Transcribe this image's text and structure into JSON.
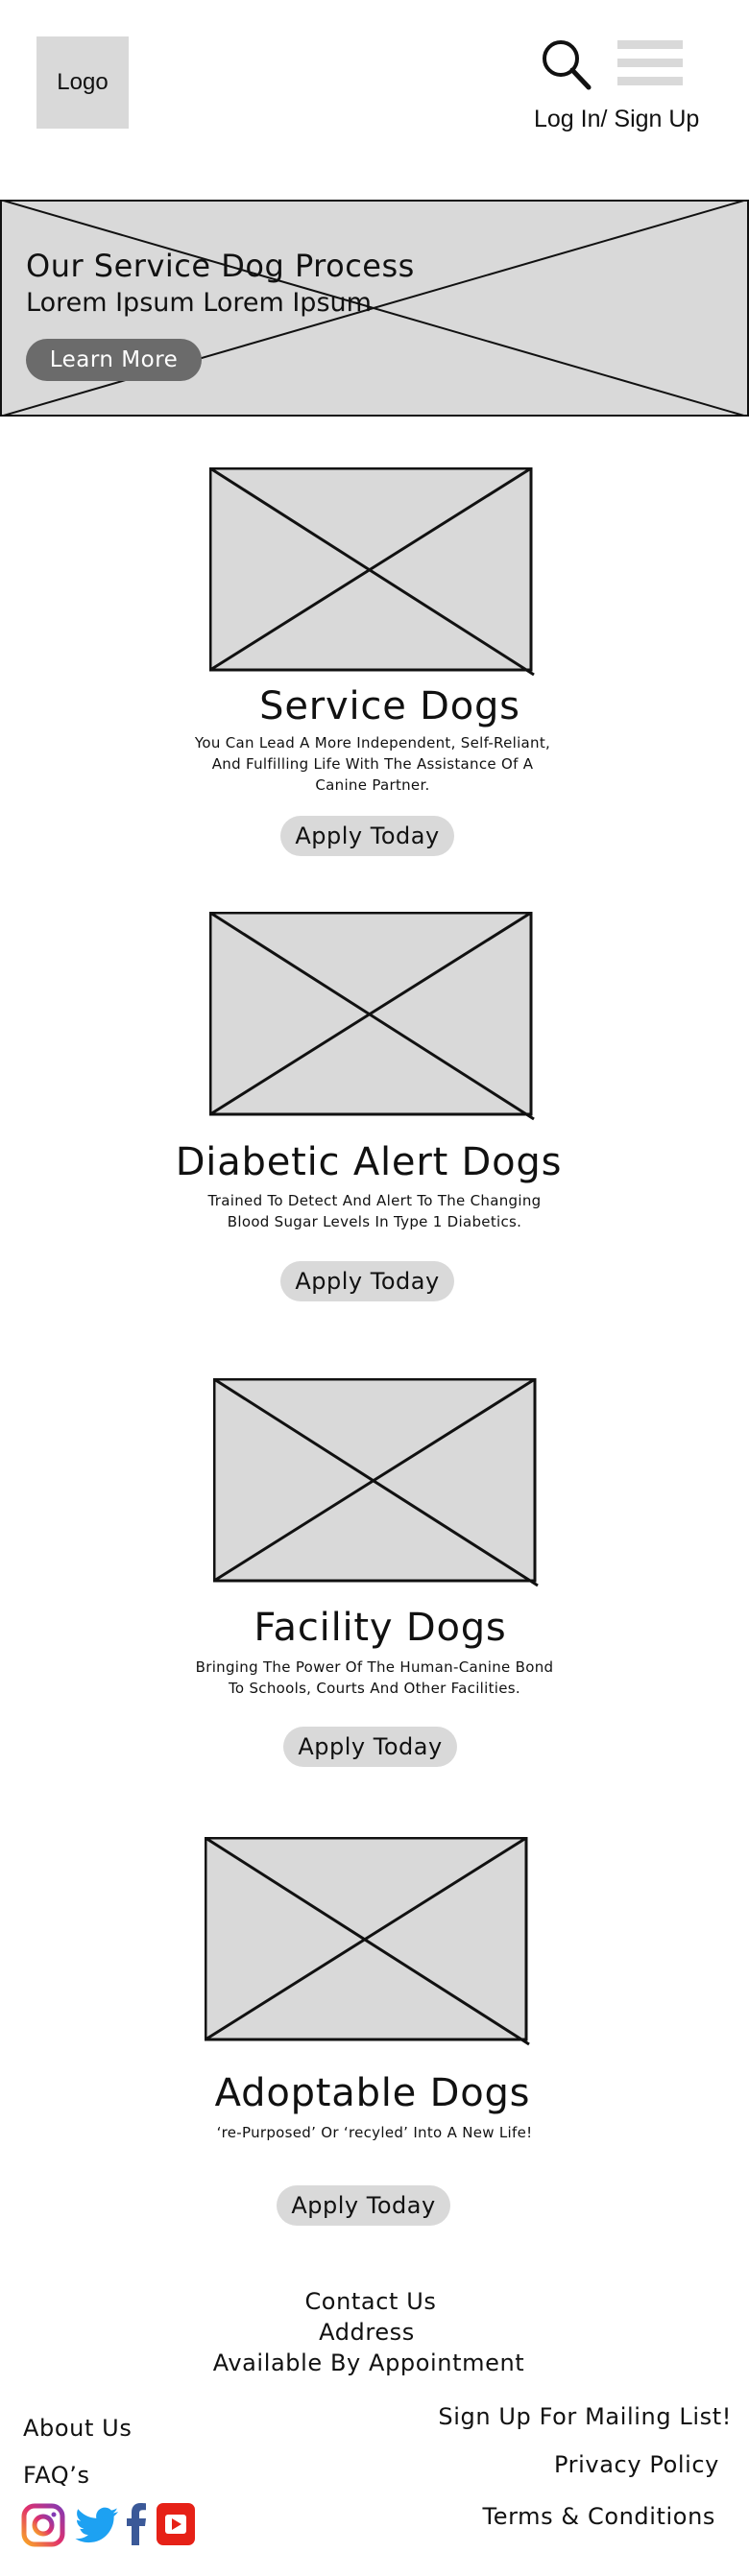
{
  "header": {
    "logo_label": "Logo",
    "login_label": "Log In/ Sign Up",
    "search_icon": "search-icon",
    "menu_icon": "hamburger-menu-icon"
  },
  "hero": {
    "title": "Our Service Dog Process",
    "subtitle": "Lorem Ipsum Lorem Ipsum",
    "button_label": "Learn More"
  },
  "cards": [
    {
      "title": "Service Dogs",
      "description": "You Can Lead A More Independent, Self-Reliant, And Fulfilling Life With The Assistance Of A Canine Partner.",
      "button_label": "Apply Today"
    },
    {
      "title": "Diabetic Alert Dogs",
      "description": "Trained To Detect And Alert To The Changing Blood Sugar Levels In Type 1 Diabetics.",
      "button_label": "Apply Today"
    },
    {
      "title": "Facility Dogs",
      "description": "Bringing The Power Of The Human-Canine Bond To Schools, Courts And Other Facilities.",
      "button_label": "Apply Today"
    },
    {
      "title": "Adoptable Dogs",
      "description": "‘re-Purposed’ Or ‘recyled’ Into A New Life!",
      "button_label": "Apply Today"
    }
  ],
  "contact": {
    "contact_us": "Contact Us",
    "address": "Address",
    "availability": "Available By Appointment"
  },
  "footer": {
    "about_us": "About Us",
    "faqs": "FAQ’s",
    "mailing_list": "Sign Up For Mailing List!",
    "privacy_policy": "Privacy Policy",
    "terms": "Terms & Conditions",
    "social_icons": [
      "instagram-icon",
      "twitter-icon",
      "facebook-icon",
      "youtube-icon"
    ]
  },
  "colors": {
    "placeholder": "#d9d9d9",
    "hero_button": "#6b6b6b",
    "instagram": "#c13584",
    "twitter": "#1da1f2",
    "facebook": "#3b5998",
    "youtube": "#e62117"
  }
}
